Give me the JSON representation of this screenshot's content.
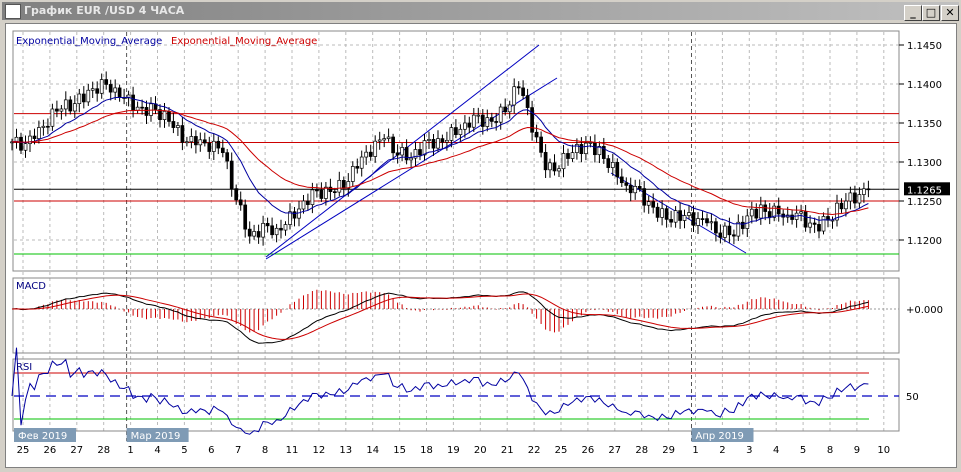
{
  "window": {
    "title": "График EUR /USD  4 ЧАСА",
    "minimize": "_",
    "maximize": "□",
    "close": "✕"
  },
  "legend": {
    "ema_fast": "Exponential_Moving_Average",
    "ema_slow": "Exponential_Moving_Average"
  },
  "price_axis": {
    "ticks": [
      "1.1450",
      "1.1400",
      "1.1350",
      "1.1300",
      "1.1250",
      "1.1200"
    ],
    "current": "1.1265"
  },
  "macd": {
    "label": "MACD",
    "zero_label": "+0.000"
  },
  "rsi": {
    "label": "RSI",
    "mid_label": "50"
  },
  "dates": [
    "25",
    "26",
    "27",
    "28",
    "1",
    "4",
    "5",
    "6",
    "7",
    "8",
    "11",
    "12",
    "13",
    "14",
    "15",
    "18",
    "19",
    "20",
    "21",
    "22",
    "25",
    "26",
    "27",
    "28",
    "29",
    "1",
    "2",
    "3",
    "4",
    "5",
    "8",
    "9",
    "10"
  ],
  "months": [
    "Фев 2019",
    "Мар 2019",
    "Апр 2019"
  ],
  "colors": {
    "ema_fast": "#0000a0",
    "ema_slow": "#cc0000",
    "level": "#cc0000",
    "support": "#00c000",
    "tag": "#7f9bb5"
  },
  "levels": {
    "resistance": [
      1.1362,
      1.1325,
      1.125
    ],
    "support": 1.1182,
    "current": 1.1265
  },
  "daily_closes": [
    1.133,
    1.1368,
    1.1392,
    1.1395,
    1.137,
    1.1352,
    1.1322,
    1.1312,
    1.1205,
    1.1215,
    1.125,
    1.1262,
    1.1292,
    1.133,
    1.1305,
    1.133,
    1.135,
    1.1352,
    1.1395,
    1.129,
    1.1312,
    1.132,
    1.127,
    1.1242,
    1.1225,
    1.1222,
    1.1205,
    1.1245,
    1.1232,
    1.122,
    1.124,
    1.1265
  ]
}
